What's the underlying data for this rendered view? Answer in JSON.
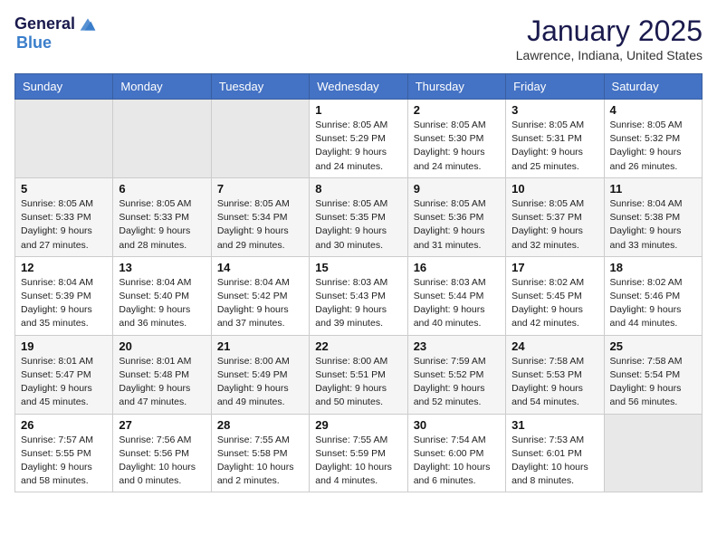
{
  "header": {
    "logo_general": "General",
    "logo_blue": "Blue",
    "month_title": "January 2025",
    "location": "Lawrence, Indiana, United States"
  },
  "days_of_week": [
    "Sunday",
    "Monday",
    "Tuesday",
    "Wednesday",
    "Thursday",
    "Friday",
    "Saturday"
  ],
  "weeks": [
    [
      {
        "num": "",
        "sunrise": "",
        "sunset": "",
        "daylight": "",
        "empty": true
      },
      {
        "num": "",
        "sunrise": "",
        "sunset": "",
        "daylight": "",
        "empty": true
      },
      {
        "num": "",
        "sunrise": "",
        "sunset": "",
        "daylight": "",
        "empty": true
      },
      {
        "num": "1",
        "sunrise": "Sunrise: 8:05 AM",
        "sunset": "Sunset: 5:29 PM",
        "daylight": "Daylight: 9 hours and 24 minutes."
      },
      {
        "num": "2",
        "sunrise": "Sunrise: 8:05 AM",
        "sunset": "Sunset: 5:30 PM",
        "daylight": "Daylight: 9 hours and 24 minutes."
      },
      {
        "num": "3",
        "sunrise": "Sunrise: 8:05 AM",
        "sunset": "Sunset: 5:31 PM",
        "daylight": "Daylight: 9 hours and 25 minutes."
      },
      {
        "num": "4",
        "sunrise": "Sunrise: 8:05 AM",
        "sunset": "Sunset: 5:32 PM",
        "daylight": "Daylight: 9 hours and 26 minutes."
      }
    ],
    [
      {
        "num": "5",
        "sunrise": "Sunrise: 8:05 AM",
        "sunset": "Sunset: 5:33 PM",
        "daylight": "Daylight: 9 hours and 27 minutes."
      },
      {
        "num": "6",
        "sunrise": "Sunrise: 8:05 AM",
        "sunset": "Sunset: 5:33 PM",
        "daylight": "Daylight: 9 hours and 28 minutes."
      },
      {
        "num": "7",
        "sunrise": "Sunrise: 8:05 AM",
        "sunset": "Sunset: 5:34 PM",
        "daylight": "Daylight: 9 hours and 29 minutes."
      },
      {
        "num": "8",
        "sunrise": "Sunrise: 8:05 AM",
        "sunset": "Sunset: 5:35 PM",
        "daylight": "Daylight: 9 hours and 30 minutes."
      },
      {
        "num": "9",
        "sunrise": "Sunrise: 8:05 AM",
        "sunset": "Sunset: 5:36 PM",
        "daylight": "Daylight: 9 hours and 31 minutes."
      },
      {
        "num": "10",
        "sunrise": "Sunrise: 8:05 AM",
        "sunset": "Sunset: 5:37 PM",
        "daylight": "Daylight: 9 hours and 32 minutes."
      },
      {
        "num": "11",
        "sunrise": "Sunrise: 8:04 AM",
        "sunset": "Sunset: 5:38 PM",
        "daylight": "Daylight: 9 hours and 33 minutes."
      }
    ],
    [
      {
        "num": "12",
        "sunrise": "Sunrise: 8:04 AM",
        "sunset": "Sunset: 5:39 PM",
        "daylight": "Daylight: 9 hours and 35 minutes."
      },
      {
        "num": "13",
        "sunrise": "Sunrise: 8:04 AM",
        "sunset": "Sunset: 5:40 PM",
        "daylight": "Daylight: 9 hours and 36 minutes."
      },
      {
        "num": "14",
        "sunrise": "Sunrise: 8:04 AM",
        "sunset": "Sunset: 5:42 PM",
        "daylight": "Daylight: 9 hours and 37 minutes."
      },
      {
        "num": "15",
        "sunrise": "Sunrise: 8:03 AM",
        "sunset": "Sunset: 5:43 PM",
        "daylight": "Daylight: 9 hours and 39 minutes."
      },
      {
        "num": "16",
        "sunrise": "Sunrise: 8:03 AM",
        "sunset": "Sunset: 5:44 PM",
        "daylight": "Daylight: 9 hours and 40 minutes."
      },
      {
        "num": "17",
        "sunrise": "Sunrise: 8:02 AM",
        "sunset": "Sunset: 5:45 PM",
        "daylight": "Daylight: 9 hours and 42 minutes."
      },
      {
        "num": "18",
        "sunrise": "Sunrise: 8:02 AM",
        "sunset": "Sunset: 5:46 PM",
        "daylight": "Daylight: 9 hours and 44 minutes."
      }
    ],
    [
      {
        "num": "19",
        "sunrise": "Sunrise: 8:01 AM",
        "sunset": "Sunset: 5:47 PM",
        "daylight": "Daylight: 9 hours and 45 minutes."
      },
      {
        "num": "20",
        "sunrise": "Sunrise: 8:01 AM",
        "sunset": "Sunset: 5:48 PM",
        "daylight": "Daylight: 9 hours and 47 minutes."
      },
      {
        "num": "21",
        "sunrise": "Sunrise: 8:00 AM",
        "sunset": "Sunset: 5:49 PM",
        "daylight": "Daylight: 9 hours and 49 minutes."
      },
      {
        "num": "22",
        "sunrise": "Sunrise: 8:00 AM",
        "sunset": "Sunset: 5:51 PM",
        "daylight": "Daylight: 9 hours and 50 minutes."
      },
      {
        "num": "23",
        "sunrise": "Sunrise: 7:59 AM",
        "sunset": "Sunset: 5:52 PM",
        "daylight": "Daylight: 9 hours and 52 minutes."
      },
      {
        "num": "24",
        "sunrise": "Sunrise: 7:58 AM",
        "sunset": "Sunset: 5:53 PM",
        "daylight": "Daylight: 9 hours and 54 minutes."
      },
      {
        "num": "25",
        "sunrise": "Sunrise: 7:58 AM",
        "sunset": "Sunset: 5:54 PM",
        "daylight": "Daylight: 9 hours and 56 minutes."
      }
    ],
    [
      {
        "num": "26",
        "sunrise": "Sunrise: 7:57 AM",
        "sunset": "Sunset: 5:55 PM",
        "daylight": "Daylight: 9 hours and 58 minutes."
      },
      {
        "num": "27",
        "sunrise": "Sunrise: 7:56 AM",
        "sunset": "Sunset: 5:56 PM",
        "daylight": "Daylight: 10 hours and 0 minutes."
      },
      {
        "num": "28",
        "sunrise": "Sunrise: 7:55 AM",
        "sunset": "Sunset: 5:58 PM",
        "daylight": "Daylight: 10 hours and 2 minutes."
      },
      {
        "num": "29",
        "sunrise": "Sunrise: 7:55 AM",
        "sunset": "Sunset: 5:59 PM",
        "daylight": "Daylight: 10 hours and 4 minutes."
      },
      {
        "num": "30",
        "sunrise": "Sunrise: 7:54 AM",
        "sunset": "Sunset: 6:00 PM",
        "daylight": "Daylight: 10 hours and 6 minutes."
      },
      {
        "num": "31",
        "sunrise": "Sunrise: 7:53 AM",
        "sunset": "Sunset: 6:01 PM",
        "daylight": "Daylight: 10 hours and 8 minutes."
      },
      {
        "num": "",
        "sunrise": "",
        "sunset": "",
        "daylight": "",
        "empty": true
      }
    ]
  ]
}
